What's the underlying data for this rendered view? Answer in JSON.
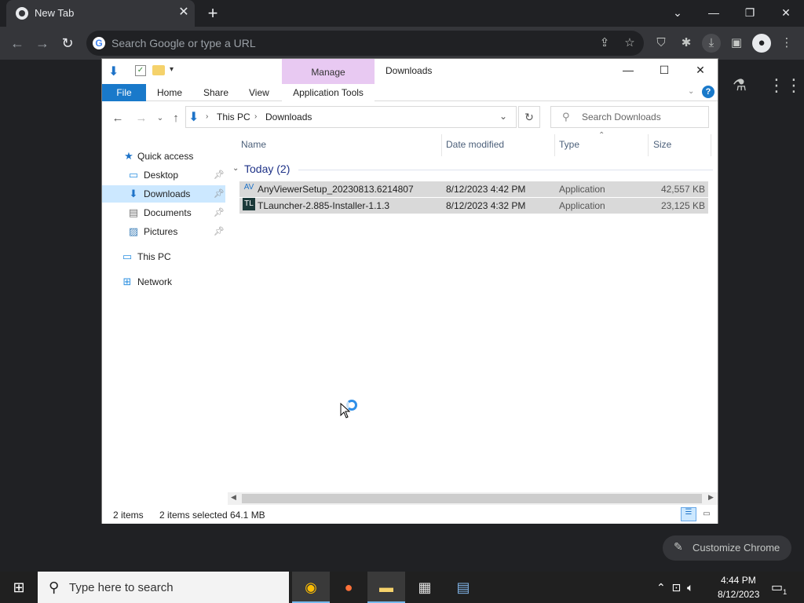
{
  "chrome": {
    "tab_title": "New Tab",
    "tab_close": "✕",
    "new_tab": "+",
    "omnibox_placeholder": "Search Google or type a URL",
    "customize_label": "Customize Chrome"
  },
  "explorer": {
    "title": "Downloads",
    "manage_tab": "Manage",
    "ribbon_tabs": {
      "file": "File",
      "home": "Home",
      "share": "Share",
      "view": "View",
      "application_tools": "Application Tools"
    },
    "breadcrumb": [
      "This PC",
      "Downloads"
    ],
    "search_placeholder": "Search Downloads",
    "nav": {
      "quick_access": "Quick access",
      "desktop": "Desktop",
      "downloads": "Downloads",
      "documents": "Documents",
      "pictures": "Pictures",
      "this_pc": "This PC",
      "network": "Network"
    },
    "columns": {
      "name": "Name",
      "date_modified": "Date modified",
      "type": "Type",
      "size": "Size"
    },
    "group_header": "Today (2)",
    "files": [
      {
        "name": "AnyViewerSetup_20230813.6214807",
        "date": "8/12/2023 4:42 PM",
        "type": "Application",
        "size": "42,557 KB"
      },
      {
        "name": "TLauncher-2.885-Installer-1.1.3",
        "date": "8/12/2023 4:32 PM",
        "type": "Application",
        "size": "23,125 KB"
      }
    ],
    "status": {
      "items": "2 items",
      "selected": "2 items selected",
      "size": "64.1 MB"
    }
  },
  "taskbar": {
    "search_placeholder": "Type here to search",
    "time": "4:44 PM",
    "date": "8/12/2023",
    "notification_count": "1"
  },
  "colors": {
    "accent": "#1979ca",
    "manage_tab": "#e8c9f2",
    "selection": "#d9d9d9"
  }
}
